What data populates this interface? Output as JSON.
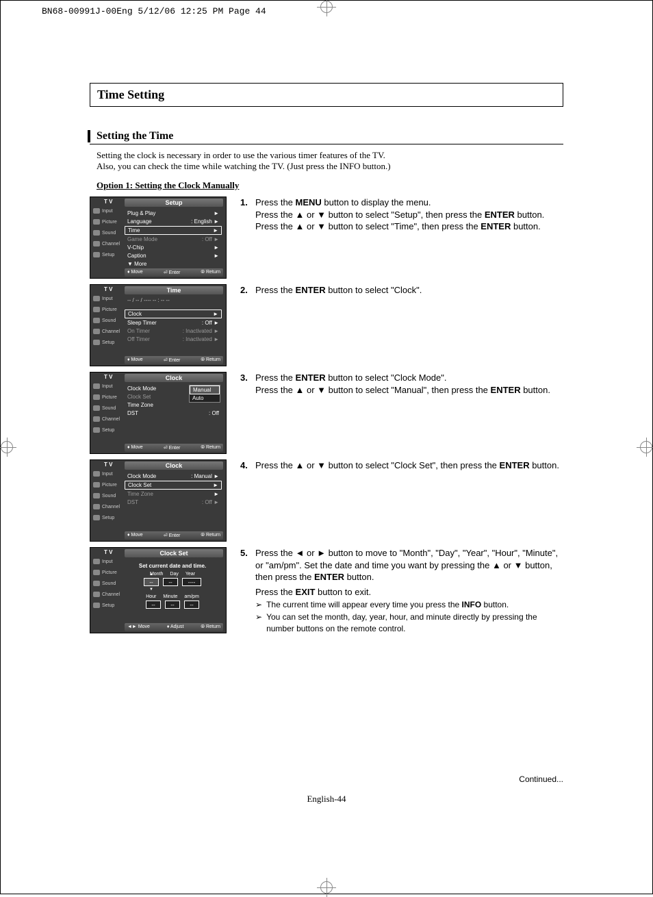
{
  "header_line": "BN68-00991J-00Eng  5/12/06  12:25 PM  Page 44",
  "section_title": "Time Setting",
  "subsection_title": "Setting the Time",
  "intro_l1": "Setting the clock is necessary in order to use the various timer features of the TV.",
  "intro_l2": "Also, you can check the time while watching the TV. (Just press the INFO button.)",
  "option_title": "Option 1: Setting the Clock Manually",
  "steps": {
    "s1": {
      "num": "1.",
      "l1a": "Press the ",
      "l1b": "MENU",
      "l1c": " button to display the menu.",
      "l2a": "Press the ▲ or ▼ button to select \"Setup\", then press the ",
      "l2b": "ENTER",
      "l2c": " button.",
      "l3a": "Press the ▲ or ▼ button to select \"Time\", then press the ",
      "l3b": "ENTER",
      "l3c": " button."
    },
    "s2": {
      "num": "2.",
      "l1a": "Press the ",
      "l1b": "ENTER",
      "l1c": " button to select \"Clock\"."
    },
    "s3": {
      "num": "3.",
      "l1a": "Press the ",
      "l1b": "ENTER",
      "l1c": " button to select \"Clock  Mode\".",
      "l2a": "Press the ▲ or ▼ button to select \"Manual\", then press the ",
      "l2b": "ENTER",
      "l2c": " button."
    },
    "s4": {
      "num": "4.",
      "l1a": "Press the ▲ or ▼ button to select \"Clock Set\", then press the ",
      "l1b": "ENTER",
      "l1c": " button."
    },
    "s5": {
      "num": "5.",
      "l1": "Press the ◄ or ► button to move to \"Month\", \"Day\", \"Year\", \"Hour\", \"Minute\", or \"am/pm\". Set the date and time you want by pressing the ▲ or ▼ button, then press the ",
      "l1b": "ENTER",
      "l1c": " button.",
      "l2a": "Press the ",
      "l2b": "EXIT",
      "l2c": " button to exit.",
      "n1a": "The current time will appear every time you press the ",
      "n1b": "INFO",
      "n1c": " button.",
      "n2": "You can set the month, day, year, hour, and minute directly by pressing the number buttons on the remote control."
    }
  },
  "sidebar": {
    "tv": "T V",
    "items": [
      "Input",
      "Picture",
      "Sound",
      "Channel",
      "Setup"
    ]
  },
  "osd_footer": {
    "move": "Move",
    "enter": "Enter",
    "return": "Return",
    "adjust": "Adjust",
    "move_lr": "Move"
  },
  "osd1": {
    "title": "Setup",
    "items": [
      {
        "label": "Plug & Play",
        "val": "",
        "sel": false,
        "dim": false
      },
      {
        "label": "Language",
        "val": ": English",
        "sel": false,
        "dim": false
      },
      {
        "label": "Time",
        "val": "",
        "sel": true,
        "dim": false
      },
      {
        "label": "Game Mode",
        "val": ": Off",
        "sel": false,
        "dim": true
      },
      {
        "label": "V-Chip",
        "val": "",
        "sel": false,
        "dim": false
      },
      {
        "label": "Caption",
        "val": "",
        "sel": false,
        "dim": false
      },
      {
        "label": "▼ More",
        "val": "",
        "sel": false,
        "dim": false
      }
    ]
  },
  "osd2": {
    "title": "Time",
    "status": "-- / -- / ----   -- : --  --",
    "items": [
      {
        "label": "Clock",
        "val": "",
        "sel": true,
        "dim": false
      },
      {
        "label": "Sleep Timer",
        "val": ": Off",
        "sel": false,
        "dim": false
      },
      {
        "label": "On Timer",
        "val": ": Inactivated",
        "sel": false,
        "dim": true
      },
      {
        "label": "Off Timer",
        "val": ": Inactivated",
        "sel": false,
        "dim": true
      }
    ]
  },
  "osd3": {
    "title": "Clock",
    "items": [
      {
        "label": "Clock Mode",
        "val": ":",
        "sel": false,
        "dim": false
      },
      {
        "label": "Clock Set",
        "val": "",
        "sel": false,
        "dim": true
      },
      {
        "label": "Time Zone",
        "val": "",
        "sel": false,
        "dim": false
      },
      {
        "label": "DST",
        "val": ": Off",
        "sel": false,
        "dim": false
      }
    ],
    "popup": [
      "Manual",
      "Auto"
    ],
    "popup_sel": 0
  },
  "osd4": {
    "title": "Clock",
    "items": [
      {
        "label": "Clock Mode",
        "val": ": Manual",
        "sel": false,
        "dim": false
      },
      {
        "label": "Clock Set",
        "val": "",
        "sel": true,
        "dim": false
      },
      {
        "label": "Time Zone",
        "val": "",
        "sel": false,
        "dim": true
      },
      {
        "label": "DST",
        "val": ": Off",
        "sel": false,
        "dim": true
      }
    ]
  },
  "osd5": {
    "title": "Clock Set",
    "msg": "Set current date and time.",
    "row1_labels": [
      "Month",
      "Day",
      "Year"
    ],
    "row1_vals": [
      "--",
      "--",
      "----"
    ],
    "row2_labels": [
      "Hour",
      "Minute",
      "am/pm"
    ],
    "row2_vals": [
      "--",
      "--",
      "--"
    ]
  },
  "continued": "Continued...",
  "pagefoot": "English-44"
}
